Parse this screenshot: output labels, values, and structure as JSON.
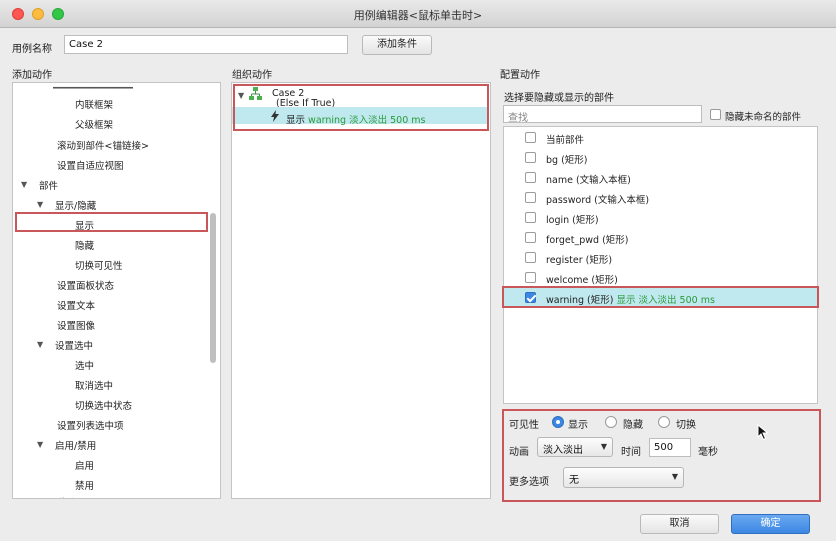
{
  "window": {
    "title": "用例编辑器<鼠标单击时>"
  },
  "case_name": {
    "label": "用例名称",
    "value": "Case 2",
    "add_condition": "添加条件"
  },
  "left": {
    "heading": "添加动作",
    "items": [
      "内联框架",
      "父级框架",
      "滚动到部件<锚链接>",
      "设置自适应视图",
      "部件",
      "显示/隐藏",
      "显示",
      "隐藏",
      "切换可见性",
      "设置面板状态",
      "设置文本",
      "设置图像",
      "设置选中",
      "选中",
      "取消选中",
      "切换选中状态",
      "设置列表选中项",
      "启用/禁用",
      "启用",
      "禁用",
      "移动"
    ]
  },
  "middle": {
    "heading": "组织动作",
    "case_title": "Case 2",
    "case_sub": "(Else If True)",
    "action_prefix": "显示",
    "action_text": "warning 淡入淡出 500 ms"
  },
  "right": {
    "heading": "配置动作",
    "subheading": "选择要隐藏或显示的部件",
    "search_placeholder": "查找",
    "hide_unnamed": "隐藏未命名的部件",
    "widgets": [
      {
        "name": "当前部件",
        "checked": false
      },
      {
        "name": "bg (矩形)",
        "checked": false
      },
      {
        "name": "name (文输入本框)",
        "checked": false
      },
      {
        "name": "password (文输入本框)",
        "checked": false
      },
      {
        "name": "login (矩形)",
        "checked": false
      },
      {
        "name": "forget_pwd (矩形)",
        "checked": false
      },
      {
        "name": "register (矩形)",
        "checked": false
      },
      {
        "name": "welcome (矩形)",
        "checked": false
      },
      {
        "name": "warning (矩形)",
        "checked": true,
        "note": "显示 淡入淡出 500 ms"
      }
    ],
    "visibility_label": "可见性",
    "visibility_options": [
      "显示",
      "隐藏",
      "切换"
    ],
    "visibility_selected": "显示",
    "animation_label": "动画",
    "animation_value": "淡入淡出",
    "time_label": "时间",
    "time_value": "500",
    "time_unit": "毫秒",
    "more_label": "更多选项",
    "more_value": "无"
  },
  "footer": {
    "cancel": "取消",
    "ok": "确定"
  },
  "colors": {
    "accent": "#3b87e3",
    "highlight": "#bfe9ef",
    "annotation": "#c9575a",
    "green": "#2a9a3a"
  }
}
